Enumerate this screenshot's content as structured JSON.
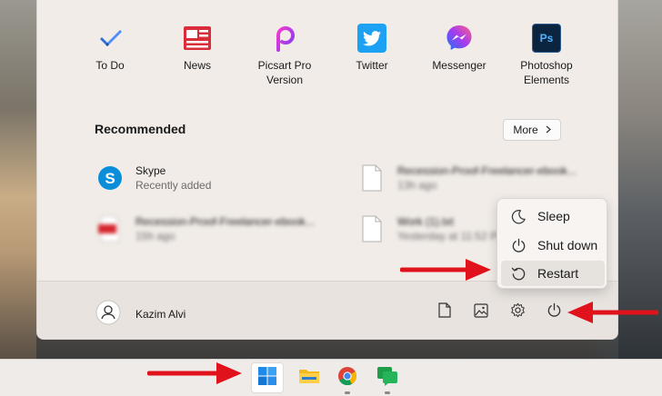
{
  "pinned_apps": [
    {
      "label": "To Do",
      "icon": "todo-icon"
    },
    {
      "label": "News",
      "icon": "news-icon"
    },
    {
      "label": "Picsart Pro Version",
      "icon": "picsart-icon"
    },
    {
      "label": "Twitter",
      "icon": "twitter-icon"
    },
    {
      "label": "Messenger",
      "icon": "messenger-icon"
    },
    {
      "label": "Photoshop Elements",
      "icon": "photoshop-icon"
    }
  ],
  "recommended": {
    "title": "Recommended",
    "more_label": "More",
    "items": [
      {
        "name": "Skype",
        "sub": "Recently added",
        "icon": "skype-icon"
      },
      {
        "name": "Recession-Proof-Freelancer-ebook...",
        "sub": "13h ago",
        "icon": "document-icon"
      },
      {
        "name": "Recession-Proof-Freelancer-ebook...",
        "sub": "15h ago",
        "icon": "pdf-icon"
      },
      {
        "name": "Work (1).txt",
        "sub": "Yesterday at 11:52 PM",
        "icon": "text-file-icon"
      }
    ]
  },
  "user": {
    "name": "Kazim Alvi"
  },
  "power_menu": {
    "items": [
      {
        "label": "Sleep",
        "icon": "sleep-icon"
      },
      {
        "label": "Shut down",
        "icon": "shutdown-icon"
      },
      {
        "label": "Restart",
        "icon": "restart-icon"
      }
    ],
    "hovered": "Restart"
  },
  "colors": {
    "annotation_red": "#e0121b",
    "accent": "#0067c0"
  }
}
